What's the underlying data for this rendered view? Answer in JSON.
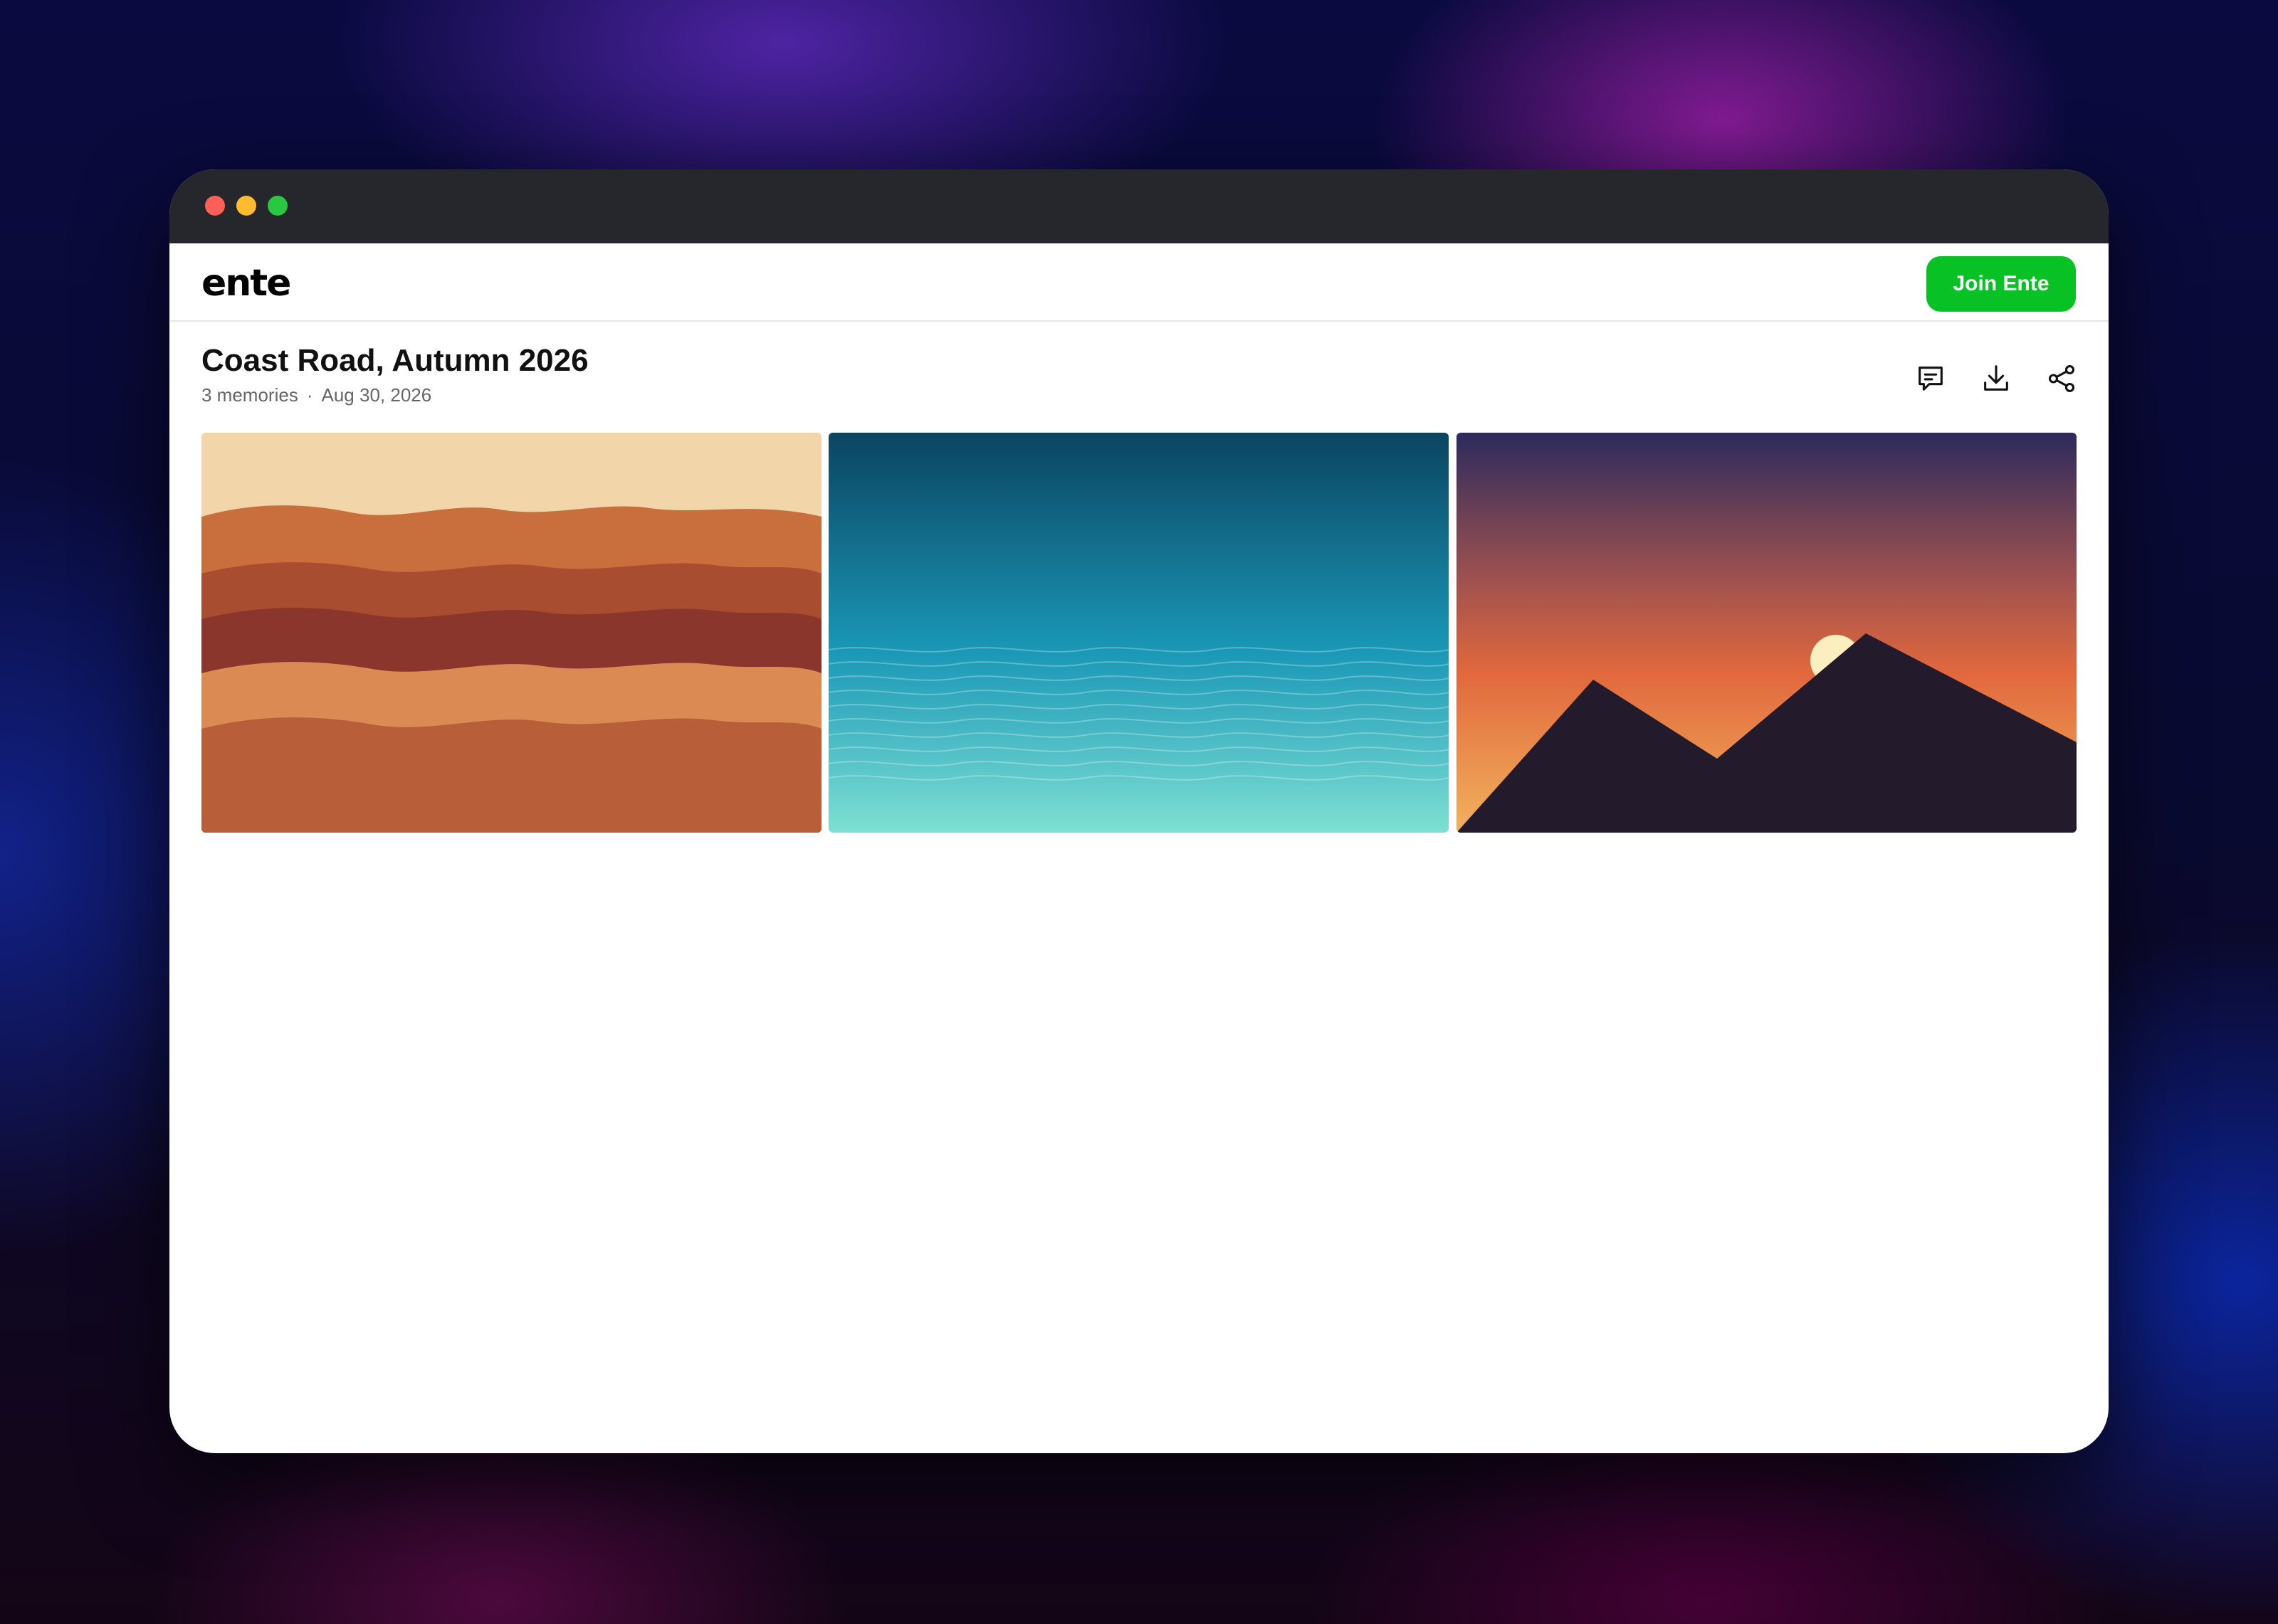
{
  "window": {
    "controls": [
      "close",
      "minimize",
      "maximize"
    ]
  },
  "header": {
    "logo_text": "ente",
    "join_button_label": "Join Ente",
    "join_button_color": "#08c225"
  },
  "album": {
    "title": "Coast Road, Autumn 2026",
    "memories_count": "3 memories",
    "separator": "·",
    "date": "Aug 30, 2026"
  },
  "actions": [
    {
      "name": "comment-icon"
    },
    {
      "name": "download-icon"
    },
    {
      "name": "share-icon"
    }
  ],
  "photos": [
    {
      "name": "desert-waves",
      "colors": [
        "#f2d6aa",
        "#c96f3e",
        "#a84d2f",
        "#8a362c",
        "#da8a52",
        "#b85e38"
      ]
    },
    {
      "name": "ocean",
      "colors": [
        "#0b4461",
        "#1a98b7",
        "#7fe0d3"
      ]
    },
    {
      "name": "sunset-mountains",
      "colors": [
        "#2c2a5c",
        "#e1683d",
        "#f2b25d",
        "#231b2c",
        "#fbefbf"
      ]
    }
  ]
}
